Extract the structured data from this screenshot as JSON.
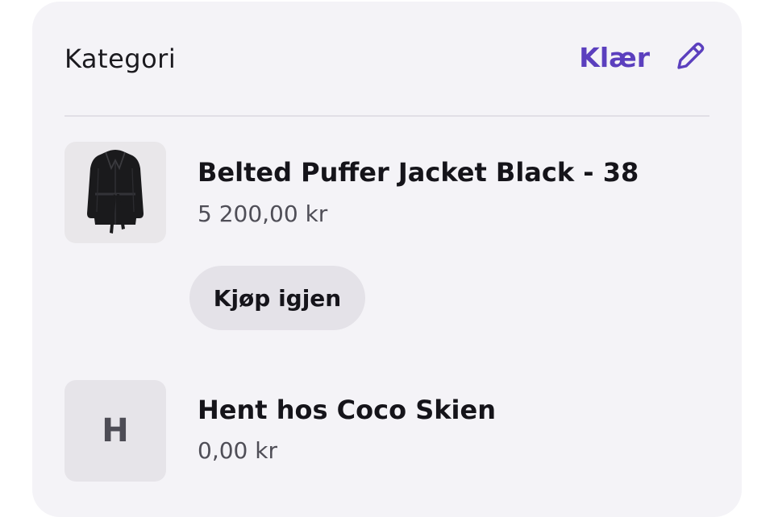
{
  "category": {
    "label": "Kategori",
    "value": "Klær",
    "edit_icon": "pencil-icon",
    "accent_color": "#5b3fbe"
  },
  "items": [
    {
      "title": "Belted Puffer Jacket Black - 38",
      "price": "5 200,00 kr",
      "thumbnail": "jacket-image",
      "action_label": "Kjøp igjen"
    },
    {
      "title": "Hent hos Coco Skien",
      "price": "0,00 kr",
      "thumbnail_letter": "H"
    }
  ]
}
